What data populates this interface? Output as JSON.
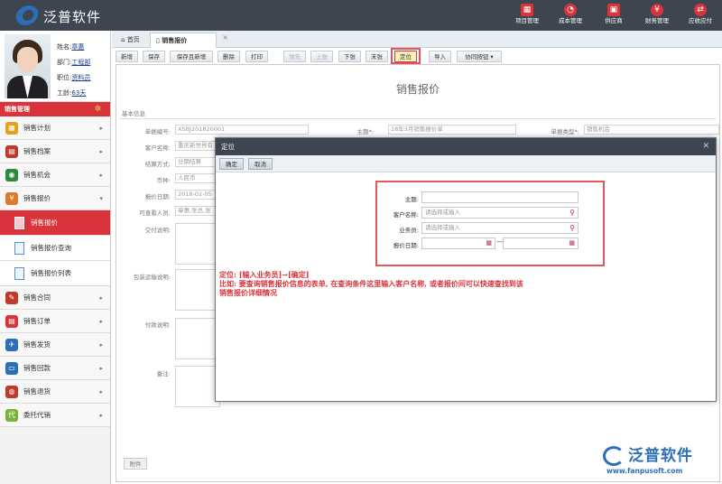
{
  "app": {
    "logo_text": "泛普软件"
  },
  "topnav": [
    {
      "label": "项目管理",
      "icon": "building-icon"
    },
    {
      "label": "成本管理",
      "icon": "pie-chart-icon"
    },
    {
      "label": "供应商",
      "icon": "supplier-icon"
    },
    {
      "label": "财务管理",
      "icon": "money-icon"
    },
    {
      "label": "应收应付",
      "icon": "receivable-icon"
    }
  ],
  "profile": {
    "name_label": "姓名:",
    "name": "章惠",
    "dept_label": "部门:",
    "dept": "工程部",
    "post_label": "职位:",
    "post": "资料员",
    "tenure_label": "工龄:",
    "tenure": "63天"
  },
  "sidebar": {
    "section": "销售管理",
    "items": [
      {
        "label": "销售计划",
        "color": "#e2a21b",
        "glyph": "▦"
      },
      {
        "label": "销售档案",
        "color": "#c0392b",
        "glyph": "▤"
      },
      {
        "label": "销售机会",
        "color": "#2c8a3d",
        "glyph": "◉"
      },
      {
        "label": "销售报价",
        "color": "#e07a2b",
        "glyph": "¥"
      }
    ],
    "sub": [
      {
        "label": "销售报价"
      },
      {
        "label": "销售报价查询"
      },
      {
        "label": "销售报价列表"
      }
    ],
    "items2": [
      {
        "label": "销售合同",
        "color": "#c0392b",
        "glyph": "✎"
      },
      {
        "label": "销售订单",
        "color": "#d9343b",
        "glyph": "▤"
      },
      {
        "label": "销售发货",
        "color": "#2c6fb7",
        "glyph": "✈"
      },
      {
        "label": "销售回款",
        "color": "#2c6fb7",
        "glyph": "▭"
      },
      {
        "label": "销售退货",
        "color": "#c0392b",
        "glyph": "◍"
      },
      {
        "label": "委托代销",
        "color": "#7bb33a",
        "glyph": "代"
      }
    ]
  },
  "tabs": {
    "home": "首页",
    "current": "销售报价"
  },
  "toolbar": [
    "新增",
    "保存",
    "保存且新增",
    "删除",
    "打印",
    "领先",
    "上张",
    "下张",
    "末张",
    "定位",
    "导入",
    "协同按钮 ▾"
  ],
  "form": {
    "title": "销售报价",
    "section": "基本信息",
    "labels": {
      "no": "单据编号:",
      "customer": "客户名称:",
      "settle": "结算方式:",
      "currency": "币种:",
      "date": "报价日期:",
      "viewer": "可查看人员:",
      "delivery": "交付说明:",
      "packing": "包装运输说明:",
      "payment": "付款说明:",
      "remark": "备注:",
      "subject": "主题*:",
      "type": "单据类型*:"
    },
    "values": {
      "no": "XSBJ201820001",
      "customer": "重庆新世界有",
      "settle": "分期结算",
      "currency": "人民币",
      "date": "2018-02-05",
      "viewer": "章惠,张总,张",
      "subject": "18年3月销售报价单",
      "type": "销售机会"
    },
    "attach": "附件"
  },
  "modal": {
    "title": "定位",
    "ok": "确定",
    "cancel": "取消",
    "fields": {
      "subject": "主题:",
      "customer": "客户名称:",
      "salesman": "业务员:",
      "date": "报价日期:"
    },
    "placeholder": "请选择或输入",
    "dash": "—",
    "note1": "定位: [输入业务员]→[确定]",
    "note2": "比如: 要查询销售报价信息的表单, 在查询条件这里输入客户名称, 或者报价间可以快速查找到该",
    "note3": "销售报价详细情况"
  },
  "brand": {
    "name": "泛普软件",
    "url": "www.fanpusoft.com"
  }
}
